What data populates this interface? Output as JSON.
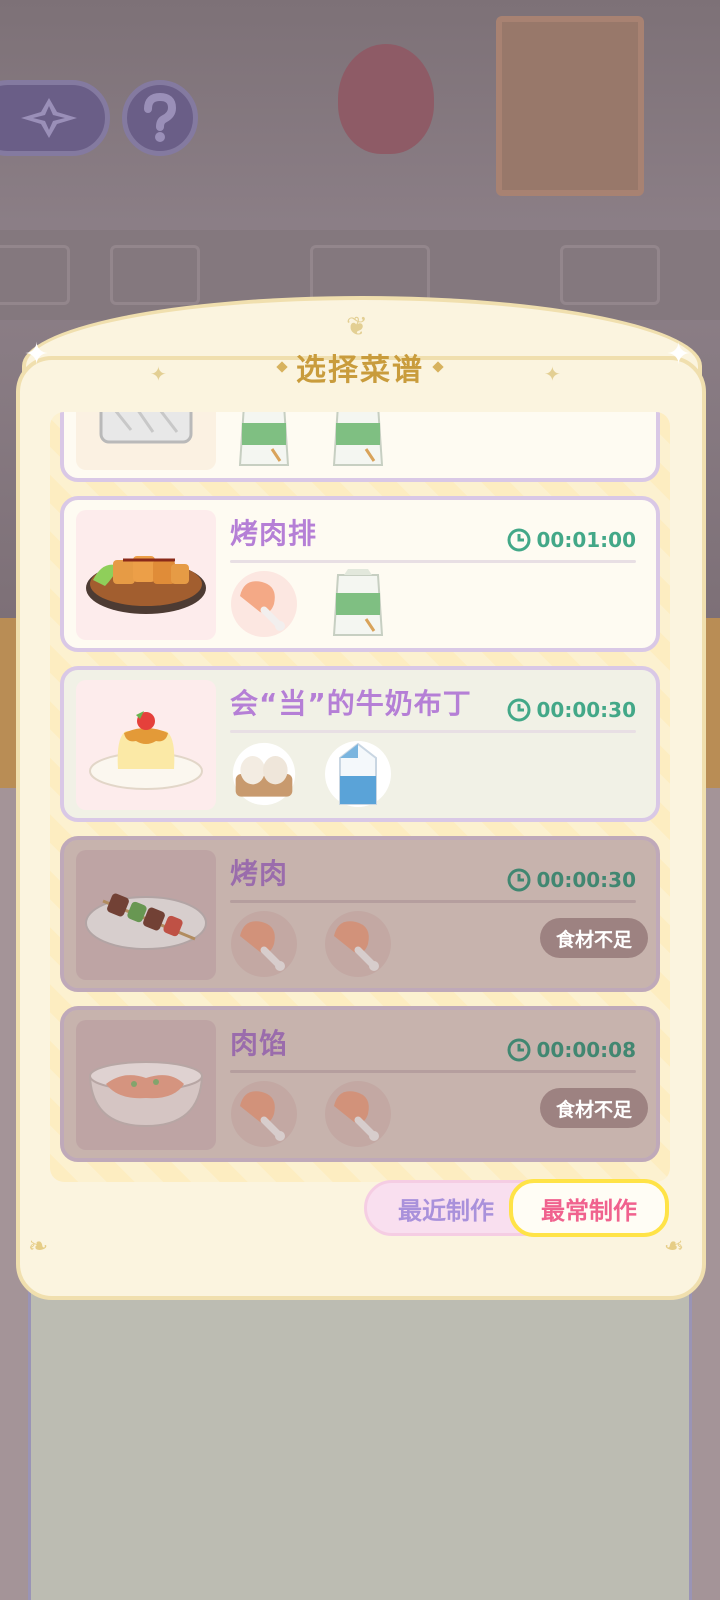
{
  "panel": {
    "title": "选择菜谱"
  },
  "recipes": [
    {
      "name": "",
      "time": "",
      "thumb_icon": "bread-loaf-icon",
      "ingredients": [
        "flour-bag-icon",
        "flour-bag-icon"
      ],
      "available": true
    },
    {
      "name": "烤肉排",
      "time": "00:01:00",
      "thumb_icon": "grilled-steak-icon",
      "ingredients": [
        "chicken-leg-icon",
        "flour-bag-icon"
      ],
      "available": true
    },
    {
      "name": "会“当”的牛奶布丁",
      "time": "00:00:30",
      "thumb_icon": "milk-pudding-icon",
      "ingredients": [
        "egg-carton-icon",
        "milk-carton-icon"
      ],
      "available": true
    },
    {
      "name": "烤肉",
      "time": "00:00:30",
      "thumb_icon": "meat-skewer-icon",
      "ingredients": [
        "chicken-leg-icon",
        "chicken-leg-icon"
      ],
      "available": false,
      "status": "食材不足"
    },
    {
      "name": "肉馅",
      "time": "00:00:08",
      "thumb_icon": "minced-meat-bowl-icon",
      "ingredients": [
        "chicken-leg-icon",
        "chicken-leg-icon"
      ],
      "available": false,
      "status": "食材不足"
    }
  ],
  "tabs": {
    "recent": "最近制作",
    "frequent": "最常制作",
    "active": "frequent"
  },
  "hud": {
    "nav_icon": "compass-star-icon",
    "help_icon": "question-icon"
  },
  "colors": {
    "title_gold": "#c99c3c",
    "recipe_name": "#b57fd6",
    "timer_green": "#43a888",
    "tab_active_border": "#ffe347",
    "tab_active_text": "#f0628e"
  }
}
